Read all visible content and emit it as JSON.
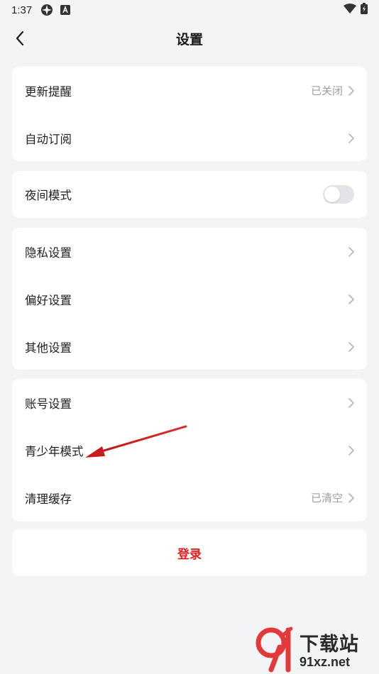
{
  "status_bar": {
    "time": "1:37"
  },
  "header": {
    "title": "设置"
  },
  "sections": {
    "notify": {
      "update_reminder": {
        "label": "更新提醒",
        "value": "已关闭"
      },
      "auto_subscribe": {
        "label": "自动订阅"
      }
    },
    "display": {
      "night_mode": {
        "label": "夜间模式",
        "enabled": false
      }
    },
    "prefs": {
      "privacy": {
        "label": "隐私设置"
      },
      "preference": {
        "label": "偏好设置"
      },
      "other": {
        "label": "其他设置"
      }
    },
    "account": {
      "account_settings": {
        "label": "账号设置"
      },
      "teen_mode": {
        "label": "青少年模式"
      },
      "clear_cache": {
        "label": "清理缓存",
        "value": "已清空"
      }
    }
  },
  "login": {
    "label": "登录"
  },
  "watermark": {
    "brand": "下载站",
    "url": "91xz.net"
  },
  "colors": {
    "background": "#f3f4f6",
    "card": "#ffffff",
    "login_text": "#e02020",
    "secondary_text": "#9e9e9e",
    "annotation_arrow": "#d62020"
  }
}
